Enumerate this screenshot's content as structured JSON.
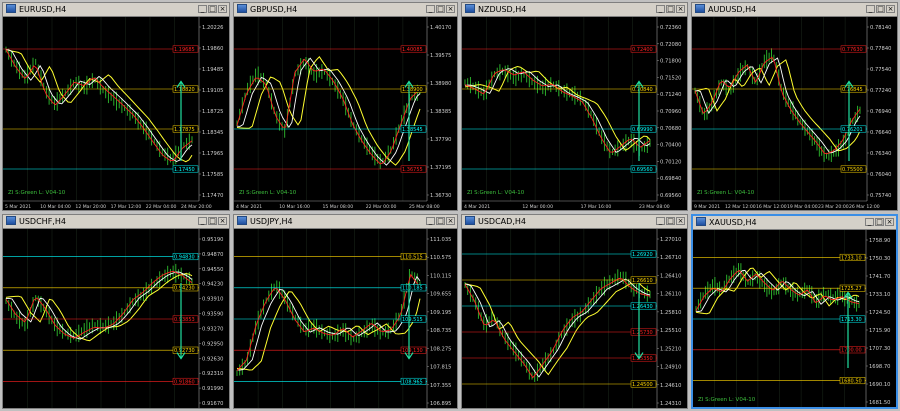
{
  "charts": [
    {
      "symbol": "EURUSD,H4",
      "title": "EURUSD,H4  1.17794 1.17948 1.17629 1.17666",
      "active": false,
      "ohlc": "",
      "y_ticks": [
        "1.20226",
        "1.19860",
        "1.19485",
        "1.19105",
        "1.18725",
        "1.18345",
        "1.17965",
        "1.17585",
        "1.17470"
      ],
      "x_ticks": [
        "5 Mar 2021",
        "10 Mar 04:00",
        "12 Mar 20:00",
        "17 Mar 12:00",
        "22 Mar 04:00",
        "24 Mar 20:00"
      ],
      "levels": [
        {
          "label": "1.19685",
          "color": "#ff2020"
        },
        {
          "label": "1.18820",
          "color": "#ffd700"
        },
        {
          "label": "1.17875",
          "color": "#ffd700"
        },
        {
          "label": "1.17450",
          "color": "#00ffff"
        }
      ],
      "note": "ZI S:Green L: V04-10",
      "up_arrow": true,
      "down_arrow": false
    },
    {
      "symbol": "GBPUSD,H4",
      "title": "GBPUSD,H4  1.37728 1.37832 1.37565 1.38354",
      "active": false,
      "ohlc": "",
      "y_ticks": [
        "1.40170",
        "1.39575",
        "1.38980",
        "1.38385",
        "1.37790",
        "1.37195",
        "1.36730"
      ],
      "x_ticks": [
        "4 Mar 2021",
        "10 Mar 16:00",
        "15 Mar 08:00",
        "22 Mar 00:00",
        "25 Mar 08:00"
      ],
      "levels": [
        {
          "label": "1.40085",
          "color": "#ff2020"
        },
        {
          "label": "1.38900",
          "color": "#ffd700"
        },
        {
          "label": "1.38545",
          "color": "#00ffff"
        },
        {
          "label": "1.36755",
          "color": "#ff2020"
        }
      ],
      "note": "ZI S:Green L: V04-10",
      "up_arrow": true,
      "down_arrow": false
    },
    {
      "symbol": "NZDUSD,H4",
      "title": "NZDUSD,H4  0.69837 0.69905 0.69714 0.69752",
      "active": false,
      "ohlc": "",
      "y_ticks": [
        "0.72360",
        "0.72080",
        "0.71800",
        "0.71520",
        "0.71240",
        "0.70960",
        "0.70680",
        "0.70400",
        "0.70120",
        "0.69840",
        "0.69560"
      ],
      "x_ticks": [
        "4 Mar 2021",
        "12 Mar 00:00",
        "17 Mar 16:00",
        "23 Mar 08:00"
      ],
      "levels": [
        {
          "label": "0.72400",
          "color": "#ff2020"
        },
        {
          "label": "0.70840",
          "color": "#ffd700"
        },
        {
          "label": "0.69990",
          "color": "#00ffff"
        },
        {
          "label": "0.69560",
          "color": "#00ffff"
        }
      ],
      "note": "ZI S:Green L: V04-10",
      "up_arrow": true,
      "down_arrow": false
    },
    {
      "symbol": "AUDUSD,H4",
      "title": "AUDUSD,H4  0.76305 0.76468 0.76150 0.76201",
      "active": false,
      "ohlc": "",
      "y_ticks": [
        "0.78140",
        "0.77840",
        "0.77540",
        "0.77240",
        "0.76940",
        "0.76640",
        "0.76340",
        "0.76040",
        "0.75740"
      ],
      "x_ticks": [
        "9 Mar 2021",
        "12 Mar 12:00",
        "16 Mar 12:00",
        "19 Mar 04:00",
        "23 Mar 20:00",
        "26 Mar 12:00"
      ],
      "levels": [
        {
          "label": "0.77630",
          "color": "#ff2020"
        },
        {
          "label": "0.76845",
          "color": "#ffd700"
        },
        {
          "label": "0.76201",
          "color": "#00ffff"
        },
        {
          "label": "0.75500",
          "color": "#ffd700"
        }
      ],
      "note": "ZI S:Green L: V04-10",
      "up_arrow": true,
      "down_arrow": false
    },
    {
      "symbol": "USDCHF,H4",
      "title": "USDCHF,H4  0.92988 0.94002 0.93762 0.93853",
      "active": false,
      "ohlc": "",
      "y_ticks": [
        "0.95190",
        "0.94870",
        "0.94550",
        "0.94230",
        "0.93910",
        "0.93590",
        "0.93270",
        "0.92950",
        "0.92630",
        "0.92310",
        "0.91990",
        "0.91670"
      ],
      "x_ticks": [],
      "levels": [
        {
          "label": "0.94830",
          "color": "#00ffff"
        },
        {
          "label": "0.94230",
          "color": "#ffd700"
        },
        {
          "label": "0.93853",
          "color": "#ff2020"
        },
        {
          "label": "0.92730",
          "color": "#ffd700"
        },
        {
          "label": "0.91860",
          "color": "#ff2020"
        }
      ],
      "note": "",
      "up_arrow": false,
      "down_arrow": true
    },
    {
      "symbol": "USDJPY,H4",
      "title": "USDJPY,H4  109.547 109.682 109.373 109.658",
      "active": false,
      "ohlc": "",
      "y_ticks": [
        "111.035",
        "110.575",
        "110.115",
        "109.655",
        "109.195",
        "108.735",
        "108.275",
        "107.815",
        "107.355",
        "106.895"
      ],
      "x_ticks": [],
      "levels": [
        {
          "label": "110.515",
          "color": "#ffd700"
        },
        {
          "label": "110.185",
          "color": "#00ffff"
        },
        {
          "label": "109.515",
          "color": "#00ffff"
        },
        {
          "label": "109.130",
          "color": "#ff2020"
        },
        {
          "label": "108.965",
          "color": "#00ffff"
        }
      ],
      "note": "",
      "up_arrow": false,
      "down_arrow": true
    },
    {
      "symbol": "USDCAD,H4",
      "title": "USDCAD,H4  1.26166 1.26269 1.25950 1.26112",
      "active": false,
      "ohlc": "",
      "y_ticks": [
        "1.27010",
        "1.26710",
        "1.26410",
        "1.26110",
        "1.25810",
        "1.25510",
        "1.25210",
        "1.24910",
        "1.24610",
        "1.24310"
      ],
      "x_ticks": [],
      "levels": [
        {
          "label": "1.26920",
          "color": "#00ffff"
        },
        {
          "label": "1.26610",
          "color": "#ffd700"
        },
        {
          "label": "1.26430",
          "color": "#00ffff"
        },
        {
          "label": "1.25730",
          "color": "#ff2020"
        },
        {
          "label": "1.25350",
          "color": "#ff2020"
        },
        {
          "label": "1.24500",
          "color": "#ffd700"
        }
      ],
      "note": "",
      "up_arrow": false,
      "down_arrow": true
    },
    {
      "symbol": "XAUUSD,H4",
      "title": "XAUUSD,H4  1728.58 1728.58 1723.78 1725.27",
      "active": true,
      "ohlc": "",
      "y_ticks": [
        "1758.90",
        "1750.30",
        "1741.70",
        "1733.10",
        "1724.50",
        "1715.90",
        "1707.30",
        "1698.70",
        "1690.10",
        "1681.50"
      ],
      "x_ticks": [],
      "levels": [
        {
          "label": "1733.10",
          "color": "#ffd700"
        },
        {
          "label": "1725.27",
          "color": "#ffd700"
        },
        {
          "label": "1713.30",
          "color": "#00ffff"
        },
        {
          "label": "1700.00",
          "color": "#ff2020"
        },
        {
          "label": "1680.50",
          "color": "#ffd700"
        }
      ],
      "note": "ZI S:Green L: V04-10",
      "up_arrow": true,
      "down_arrow": false
    }
  ]
}
